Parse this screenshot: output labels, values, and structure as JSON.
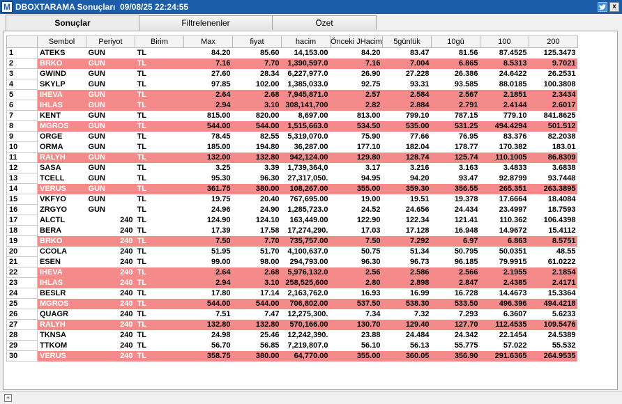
{
  "window": {
    "app_icon": "M",
    "title": "DBOXTARAMA Sonuçları  09/08/25 22:24:55",
    "twitter_icon": "twitter-icon",
    "close_glyph": "x"
  },
  "tabs": [
    {
      "label": "Sonuçlar",
      "active": true
    },
    {
      "label": "Filtrelenenler",
      "active": false
    },
    {
      "label": "Özet",
      "active": false
    }
  ],
  "table": {
    "columns": [
      "",
      "Sembol",
      "Periyot",
      "Birim",
      "Max",
      "fiyat",
      "hacim",
      "Önceki JHacim",
      "5günlük",
      "10gü",
      "100",
      "200"
    ],
    "highlight_color": "#f48a8a",
    "rows": [
      {
        "i": "1",
        "sym": "ATEKS",
        "per": "GUN",
        "unit": "TL",
        "max": "84.20",
        "fiyat": "85.60",
        "hacim": "14,153.00",
        "onceki": "84.20",
        "g5": "83.47",
        "g10": "81.56",
        "m100": "87.4525",
        "m200": "125.3473",
        "hl": false
      },
      {
        "i": "2",
        "sym": "BRKO",
        "per": "GUN",
        "unit": "TL",
        "max": "7.16",
        "fiyat": "7.70",
        "hacim": "1,390,597.0",
        "onceki": "7.16",
        "g5": "7.004",
        "g10": "6.865",
        "m100": "8.5313",
        "m200": "9.7021",
        "hl": true
      },
      {
        "i": "3",
        "sym": "GWIND",
        "per": "GUN",
        "unit": "TL",
        "max": "27.60",
        "fiyat": "28.34",
        "hacim": "6,227,977.0",
        "onceki": "26.90",
        "g5": "27.228",
        "g10": "26.386",
        "m100": "24.6422",
        "m200": "26.2531",
        "hl": false
      },
      {
        "i": "4",
        "sym": "SKYLP",
        "per": "GUN",
        "unit": "TL",
        "max": "97.85",
        "fiyat": "102.00",
        "hacim": "1,385,033.0",
        "onceki": "92.75",
        "g5": "93.31",
        "g10": "93.585",
        "m100": "88.0185",
        "m200": "100.3808",
        "hl": false
      },
      {
        "i": "5",
        "sym": "IHEVA",
        "per": "GUN",
        "unit": "TL",
        "max": "2.64",
        "fiyat": "2.68",
        "hacim": "7,945,871.0",
        "onceki": "2.57",
        "g5": "2.584",
        "g10": "2.567",
        "m100": "2.1851",
        "m200": "2.3434",
        "hl": true
      },
      {
        "i": "6",
        "sym": "IHLAS",
        "per": "GUN",
        "unit": "TL",
        "max": "2.94",
        "fiyat": "3.10",
        "hacim": "308,141,700",
        "onceki": "2.82",
        "g5": "2.884",
        "g10": "2.791",
        "m100": "2.4144",
        "m200": "2.6017",
        "hl": true
      },
      {
        "i": "7",
        "sym": "KENT",
        "per": "GUN",
        "unit": "TL",
        "max": "815.00",
        "fiyat": "820.00",
        "hacim": "8,697.00",
        "onceki": "813.00",
        "g5": "799.10",
        "g10": "787.15",
        "m100": "779.10",
        "m200": "841.8625",
        "hl": false
      },
      {
        "i": "8",
        "sym": "MGROS",
        "per": "GUN",
        "unit": "TL",
        "max": "544.00",
        "fiyat": "544.00",
        "hacim": "1,515,663.0",
        "onceki": "534.50",
        "g5": "535.00",
        "g10": "531.25",
        "m100": "494.4294",
        "m200": "501.512",
        "hl": true
      },
      {
        "i": "9",
        "sym": "ORGE",
        "per": "GUN",
        "unit": "TL",
        "max": "78.45",
        "fiyat": "82.55",
        "hacim": "5,319,070.0",
        "onceki": "75.90",
        "g5": "77.66",
        "g10": "76.95",
        "m100": "83.376",
        "m200": "82.2038",
        "hl": false
      },
      {
        "i": "10",
        "sym": "ORMA",
        "per": "GUN",
        "unit": "TL",
        "max": "185.00",
        "fiyat": "194.80",
        "hacim": "36,287.00",
        "onceki": "177.10",
        "g5": "182.04",
        "g10": "178.77",
        "m100": "170.382",
        "m200": "183.01",
        "hl": false
      },
      {
        "i": "11",
        "sym": "RALYH",
        "per": "GUN",
        "unit": "TL",
        "max": "132.00",
        "fiyat": "132.80",
        "hacim": "942,124.00",
        "onceki": "129.80",
        "g5": "128.74",
        "g10": "125.74",
        "m100": "110.1005",
        "m200": "86.8309",
        "hl": true
      },
      {
        "i": "12",
        "sym": "SASA",
        "per": "GUN",
        "unit": "TL",
        "max": "3.25",
        "fiyat": "3.39",
        "hacim": "1,739,364,0",
        "onceki": "3.17",
        "g5": "3.216",
        "g10": "3.163",
        "m100": "3.4833",
        "m200": "3.6838",
        "hl": false
      },
      {
        "i": "13",
        "sym": "TCELL",
        "per": "GUN",
        "unit": "TL",
        "max": "95.30",
        "fiyat": "96.30",
        "hacim": "27,317,050.",
        "onceki": "94.95",
        "g5": "94.20",
        "g10": "93.47",
        "m100": "92.8799",
        "m200": "93.7448",
        "hl": false
      },
      {
        "i": "14",
        "sym": "VERUS",
        "per": "GUN",
        "unit": "TL",
        "max": "361.75",
        "fiyat": "380.00",
        "hacim": "108,267.00",
        "onceki": "355.00",
        "g5": "359.30",
        "g10": "356.55",
        "m100": "265.351",
        "m200": "263.3895",
        "hl": true
      },
      {
        "i": "15",
        "sym": "VKFYO",
        "per": "GUN",
        "unit": "TL",
        "max": "19.75",
        "fiyat": "20.40",
        "hacim": "767,695.00",
        "onceki": "19.00",
        "g5": "19.51",
        "g10": "19.378",
        "m100": "17.6664",
        "m200": "18.4084",
        "hl": false
      },
      {
        "i": "16",
        "sym": "ZRGYO",
        "per": "GUN",
        "unit": "TL",
        "max": "24.96",
        "fiyat": "24.90",
        "hacim": "1,285,723.0",
        "onceki": "24.52",
        "g5": "24.656",
        "g10": "24.434",
        "m100": "23.4997",
        "m200": "18.7593",
        "hl": false
      },
      {
        "i": "17",
        "sym": "ALCTL",
        "per": "240",
        "unit": "TL",
        "max": "124.90",
        "fiyat": "124.10",
        "hacim": "163,449.00",
        "onceki": "122.90",
        "g5": "122.34",
        "g10": "121.41",
        "m100": "110.362",
        "m200": "106.4398",
        "hl": false
      },
      {
        "i": "18",
        "sym": "BERA",
        "per": "240",
        "unit": "TL",
        "max": "17.39",
        "fiyat": "17.58",
        "hacim": "17,274,290.",
        "onceki": "17.03",
        "g5": "17.128",
        "g10": "16.948",
        "m100": "14.9672",
        "m200": "15.4112",
        "hl": false
      },
      {
        "i": "19",
        "sym": "BRKO",
        "per": "240",
        "unit": "TL",
        "max": "7.50",
        "fiyat": "7.70",
        "hacim": "735,757.00",
        "onceki": "7.50",
        "g5": "7.292",
        "g10": "6.97",
        "m100": "6.863",
        "m200": "8.5751",
        "hl": true
      },
      {
        "i": "20",
        "sym": "CCOLA",
        "per": "240",
        "unit": "TL",
        "max": "51.95",
        "fiyat": "51.70",
        "hacim": "4,100,637.0",
        "onceki": "50.75",
        "g5": "51.34",
        "g10": "50.795",
        "m100": "50.0351",
        "m200": "48.55",
        "hl": false
      },
      {
        "i": "21",
        "sym": "ESEN",
        "per": "240",
        "unit": "TL",
        "max": "99.00",
        "fiyat": "98.00",
        "hacim": "294,793.00",
        "onceki": "96.30",
        "g5": "96.73",
        "g10": "96.185",
        "m100": "79.9915",
        "m200": "61.0222",
        "hl": false
      },
      {
        "i": "22",
        "sym": "IHEVA",
        "per": "240",
        "unit": "TL",
        "max": "2.64",
        "fiyat": "2.68",
        "hacim": "5,976,132.0",
        "onceki": "2.56",
        "g5": "2.586",
        "g10": "2.566",
        "m100": "2.1955",
        "m200": "2.1854",
        "hl": true
      },
      {
        "i": "23",
        "sym": "IHLAS",
        "per": "240",
        "unit": "TL",
        "max": "2.94",
        "fiyat": "3.10",
        "hacim": "258,525,600",
        "onceki": "2.80",
        "g5": "2.898",
        "g10": "2.847",
        "m100": "2.4385",
        "m200": "2.4171",
        "hl": true
      },
      {
        "i": "24",
        "sym": "BESLR",
        "per": "240",
        "unit": "TL",
        "max": "17.80",
        "fiyat": "17.14",
        "hacim": "2,163,762.0",
        "onceki": "16.93",
        "g5": "16.99",
        "g10": "16.728",
        "m100": "14.4673",
        "m200": "15.3364",
        "hl": false
      },
      {
        "i": "25",
        "sym": "MGROS",
        "per": "240",
        "unit": "TL",
        "max": "544.00",
        "fiyat": "544.00",
        "hacim": "706,802.00",
        "onceki": "537.50",
        "g5": "538.30",
        "g10": "533.50",
        "m100": "496.396",
        "m200": "494.4218",
        "hl": true
      },
      {
        "i": "26",
        "sym": "QUAGR",
        "per": "240",
        "unit": "TL",
        "max": "7.51",
        "fiyat": "7.47",
        "hacim": "12,275,300.",
        "onceki": "7.34",
        "g5": "7.32",
        "g10": "7.293",
        "m100": "6.3607",
        "m200": "5.6233",
        "hl": false
      },
      {
        "i": "27",
        "sym": "RALYH",
        "per": "240",
        "unit": "TL",
        "max": "132.80",
        "fiyat": "132.80",
        "hacim": "570,166.00",
        "onceki": "130.70",
        "g5": "129.40",
        "g10": "127.70",
        "m100": "112.4535",
        "m200": "109.5476",
        "hl": true
      },
      {
        "i": "28",
        "sym": "TKNSA",
        "per": "240",
        "unit": "TL",
        "max": "24.98",
        "fiyat": "25.46",
        "hacim": "12,242,390.",
        "onceki": "23.88",
        "g5": "24.484",
        "g10": "24.342",
        "m100": "22.1454",
        "m200": "24.5389",
        "hl": false
      },
      {
        "i": "29",
        "sym": "TTKOM",
        "per": "240",
        "unit": "TL",
        "max": "56.70",
        "fiyat": "56.85",
        "hacim": "7,219,807.0",
        "onceki": "56.10",
        "g5": "56.13",
        "g10": "55.775",
        "m100": "57.022",
        "m200": "55.532",
        "hl": false
      },
      {
        "i": "30",
        "sym": "VERUS",
        "per": "240",
        "unit": "TL",
        "max": "358.75",
        "fiyat": "380.00",
        "hacim": "64,770.00",
        "onceki": "355.00",
        "g5": "360.05",
        "g10": "356.90",
        "m100": "291.6365",
        "m200": "264.9535",
        "hl": true
      }
    ]
  },
  "statusbar": {
    "expand_glyph": "+"
  }
}
